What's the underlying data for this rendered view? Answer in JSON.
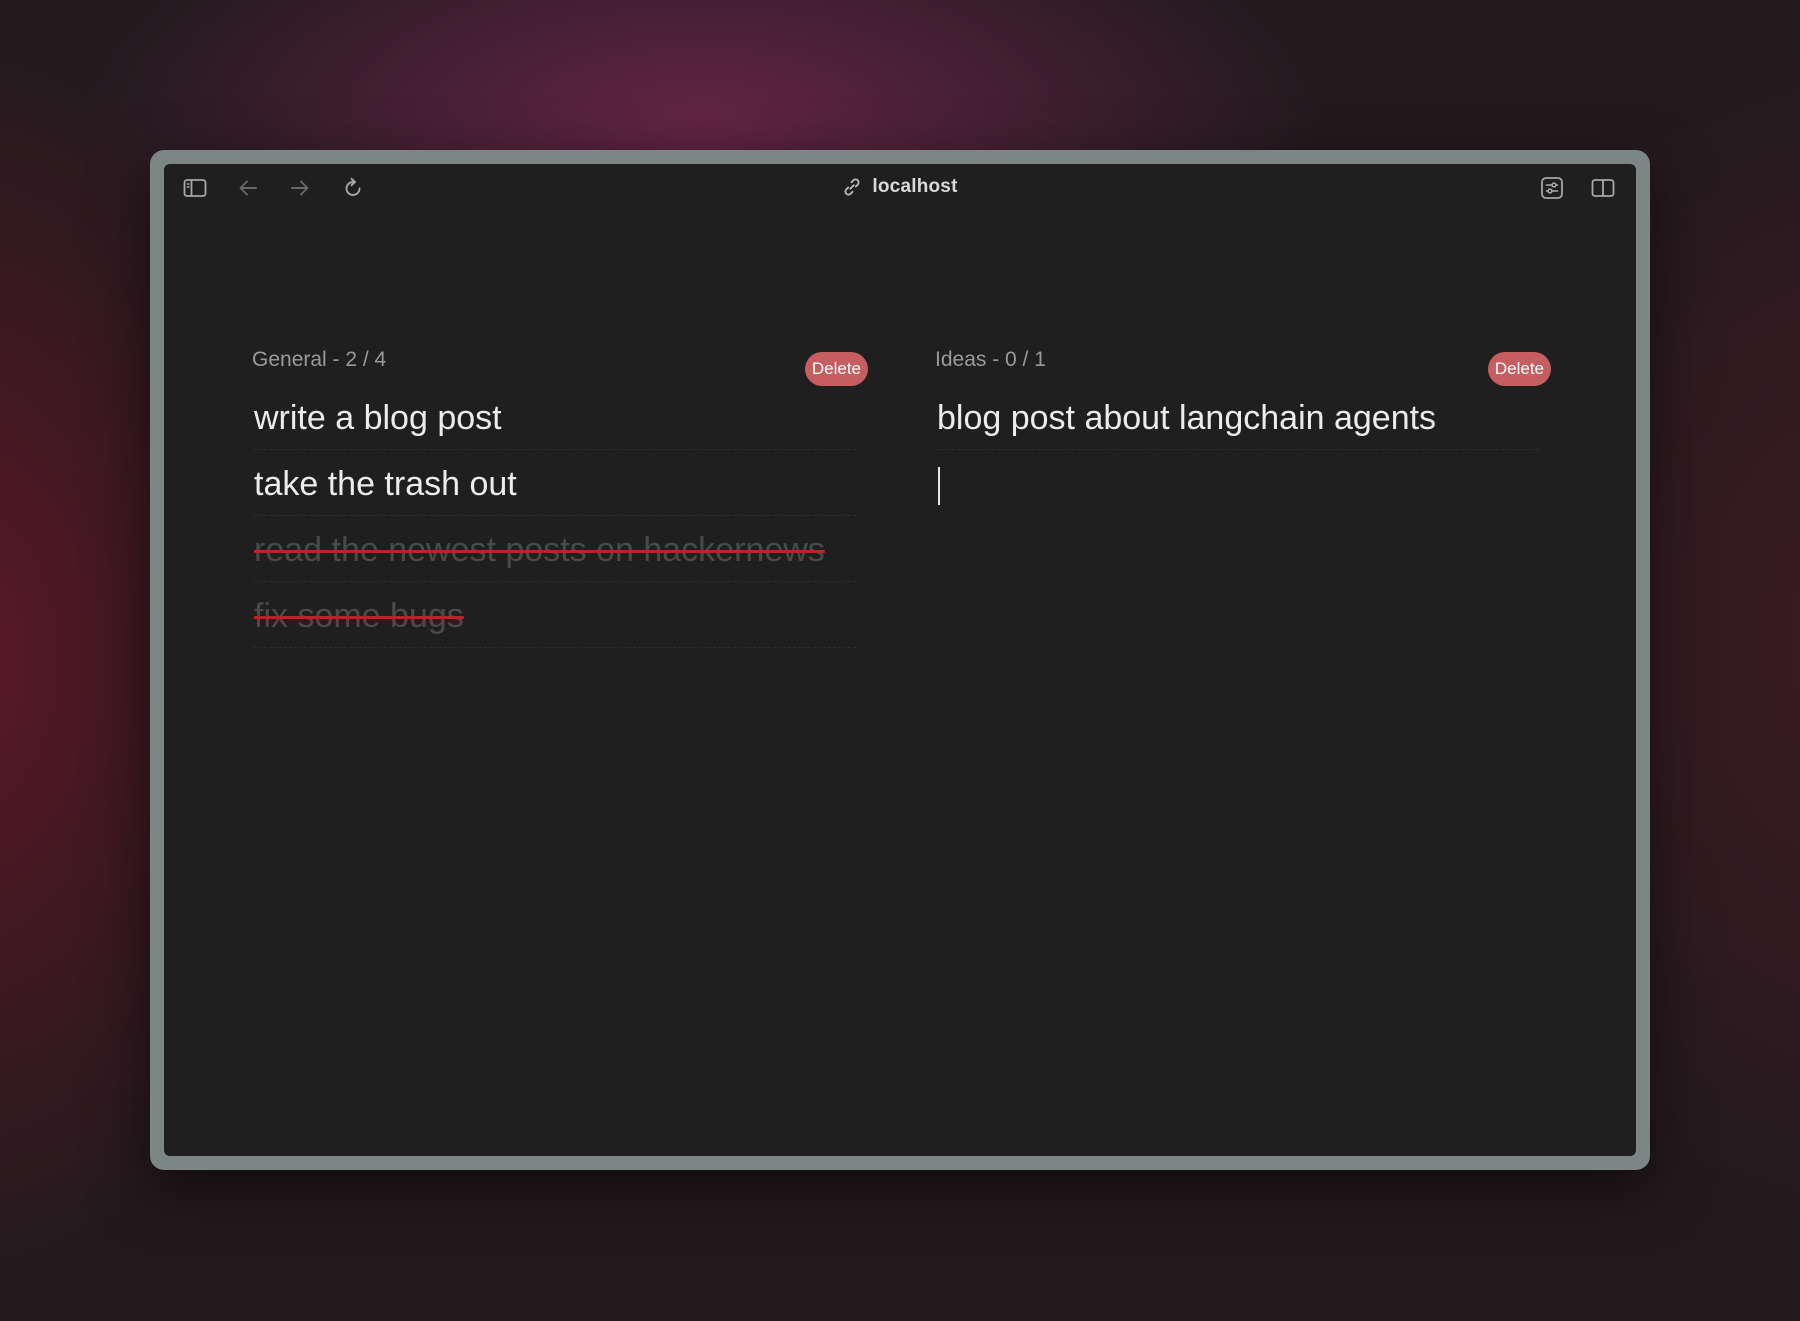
{
  "browser": {
    "address": "localhost",
    "icons": {
      "sidebar": "sidebar-toggle-icon",
      "back": "arrow-left-icon",
      "forward": "arrow-right-icon",
      "reload": "reload-icon",
      "link": "link-icon",
      "extensions": "sliders-icon",
      "split": "split-view-icon"
    }
  },
  "lists": [
    {
      "title": "General - 2 / 4",
      "delete_label": "Delete",
      "items": [
        {
          "text": "write a blog post",
          "done": false
        },
        {
          "text": "take the trash out",
          "done": false
        },
        {
          "text": "read the newest posts on hackernews",
          "done": true
        },
        {
          "text": "fix some bugs",
          "done": true
        }
      ]
    },
    {
      "title": "Ideas - 0 / 1",
      "delete_label": "Delete",
      "items": [
        {
          "text": "blog post about langchain agents",
          "done": false
        }
      ],
      "new_item_value": ""
    }
  ],
  "colors": {
    "delete_button": "#c65d60",
    "strikethrough": "#b3262b",
    "window_background": "#1f1f1f"
  }
}
